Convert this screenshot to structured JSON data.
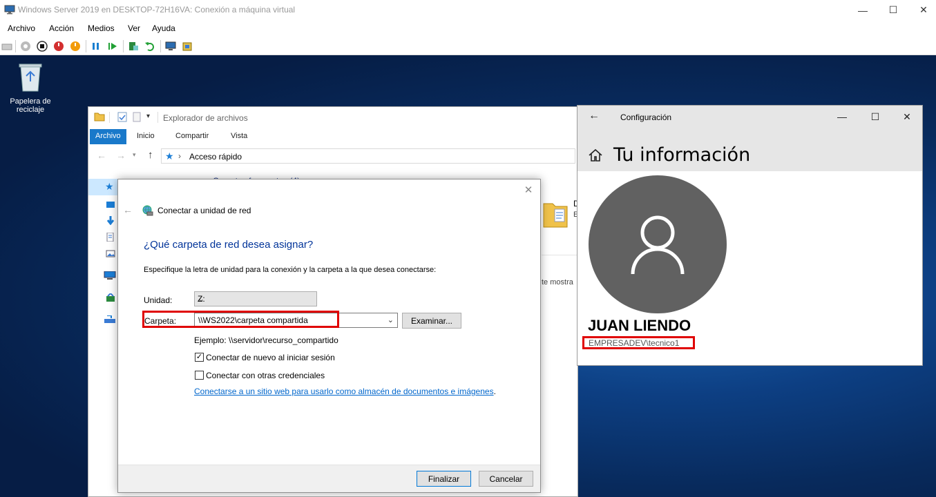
{
  "host": {
    "title": "Windows Server 2019 en DESKTOP-72H16VA: Conexión a máquina virtual",
    "menu": [
      "Archivo",
      "Acción",
      "Medios",
      "Ver",
      "Ayuda"
    ]
  },
  "desktop": {
    "recycle_bin_label": "Papelera de reciclaje"
  },
  "explorer": {
    "title": "Explorador de archivos",
    "tabs": [
      "Archivo",
      "Inicio",
      "Compartir",
      "Vista"
    ],
    "address": "Acceso rápido",
    "partial_section": "Carpetas frecuentes (4)",
    "partial_item_title": "D",
    "partial_item_sub": "E",
    "partial_msg": "te mostra"
  },
  "dialog": {
    "title": "Conectar a unidad de red",
    "heading": "¿Qué carpeta de red desea asignar?",
    "instructions": "Especifique la letra de unidad para la conexión y la carpeta a la que desea conectarse:",
    "unit_label": "Unidad:",
    "unit_value": "Z:",
    "folder_label": "Carpeta:",
    "folder_value": "\\\\WS2022\\carpeta compartida",
    "browse_label": "Examinar...",
    "example": "Ejemplo: \\\\servidor\\recurso_compartido",
    "reconnect_label": "Conectar de nuevo al iniciar sesión",
    "reconnect_checked": true,
    "other_creds_label": "Conectar con otras credenciales",
    "other_creds_checked": false,
    "link_text": "Conectarse a un sitio web para usarlo como almacén de documentos e imágenes",
    "link_suffix": ".",
    "finish_label": "Finalizar",
    "cancel_label": "Cancelar"
  },
  "settings": {
    "title": "Configuración",
    "heading": "Tu información",
    "user_name": "JUAN LIENDO",
    "account": "EMPRESADEV\\tecnico1"
  },
  "colors": {
    "accent": "#1979ca",
    "highlight_border": "#e00000",
    "link": "#0066cc",
    "avatar": "#616161"
  }
}
